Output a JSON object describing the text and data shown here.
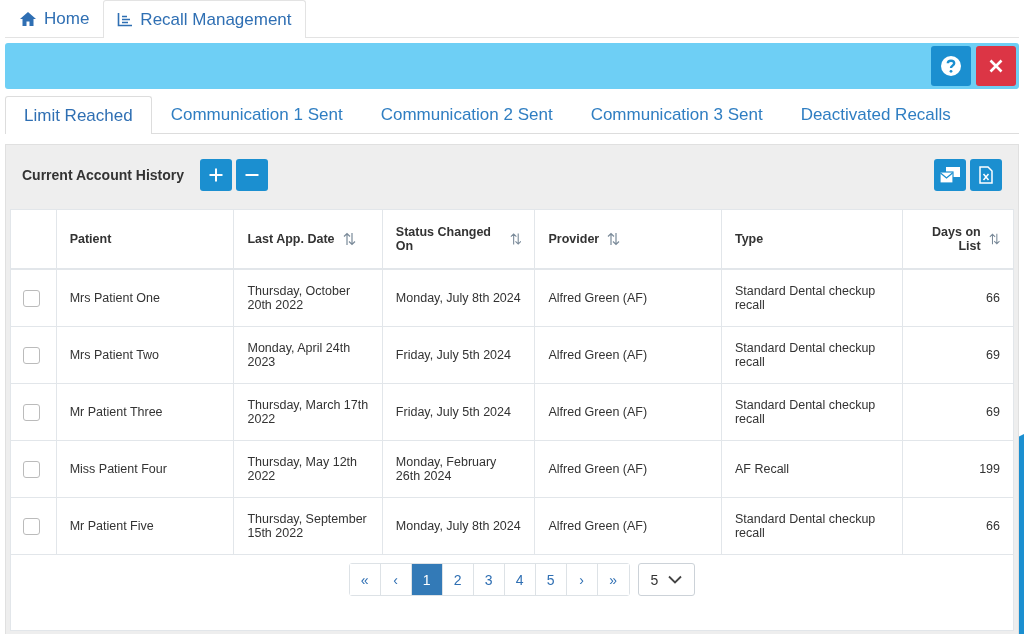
{
  "top_tabs": [
    {
      "label": "Home",
      "selected": false
    },
    {
      "label": "Recall Management",
      "selected": true
    }
  ],
  "sub_tabs": [
    {
      "label": "Limit Reached",
      "selected": true
    },
    {
      "label": "Communication 1 Sent",
      "selected": false
    },
    {
      "label": "Communication 2 Sent",
      "selected": false
    },
    {
      "label": "Communication 3 Sent",
      "selected": false
    },
    {
      "label": "Deactivated Recalls",
      "selected": false
    }
  ],
  "panel": {
    "title": "Current Account History"
  },
  "table": {
    "columns": [
      {
        "label": "Patient",
        "sortable": false
      },
      {
        "label": "Last App. Date",
        "sortable": true
      },
      {
        "label": "Status Changed On",
        "sortable": true
      },
      {
        "label": "Provider",
        "sortable": true
      },
      {
        "label": "Type",
        "sortable": false
      },
      {
        "label": "Days on List",
        "sortable": true
      }
    ],
    "rows": [
      {
        "checked": false,
        "cells": [
          "Mrs Patient One",
          "Thursday, October 20th 2022",
          "Monday, July 8th 2024",
          "Alfred Green (AF)",
          "Standard Dental checkup recall",
          "66"
        ]
      },
      {
        "checked": false,
        "cells": [
          "Mrs Patient Two",
          "Monday, April 24th 2023",
          "Friday, July 5th 2024",
          "Alfred Green (AF)",
          "Standard Dental checkup recall",
          "69"
        ]
      },
      {
        "checked": false,
        "cells": [
          "Mr Patient Three",
          "Thursday, March 17th 2022",
          "Friday, July 5th 2024",
          "Alfred Green (AF)",
          "Standard Dental checkup recall",
          "69"
        ]
      },
      {
        "checked": false,
        "cells": [
          "Miss Patient Four",
          "Thursday, May 12th 2022",
          "Monday, February 26th 2024",
          "Alfred Green (AF)",
          "AF Recall",
          "199"
        ]
      },
      {
        "checked": false,
        "cells": [
          "Mr Patient Five",
          "Thursday, September 15th 2022",
          "Monday, July 8th 2024",
          "Alfred Green (AF)",
          "Standard Dental checkup recall",
          "66"
        ]
      }
    ]
  },
  "pagination": {
    "first": "«",
    "prev": "‹",
    "pages": [
      {
        "label": "1",
        "selected": true
      },
      {
        "label": "2",
        "selected": false
      },
      {
        "label": "3",
        "selected": false
      },
      {
        "label": "4",
        "selected": false
      },
      {
        "label": "5",
        "selected": false
      }
    ],
    "next": "›",
    "last": "»",
    "page_size": "5"
  }
}
